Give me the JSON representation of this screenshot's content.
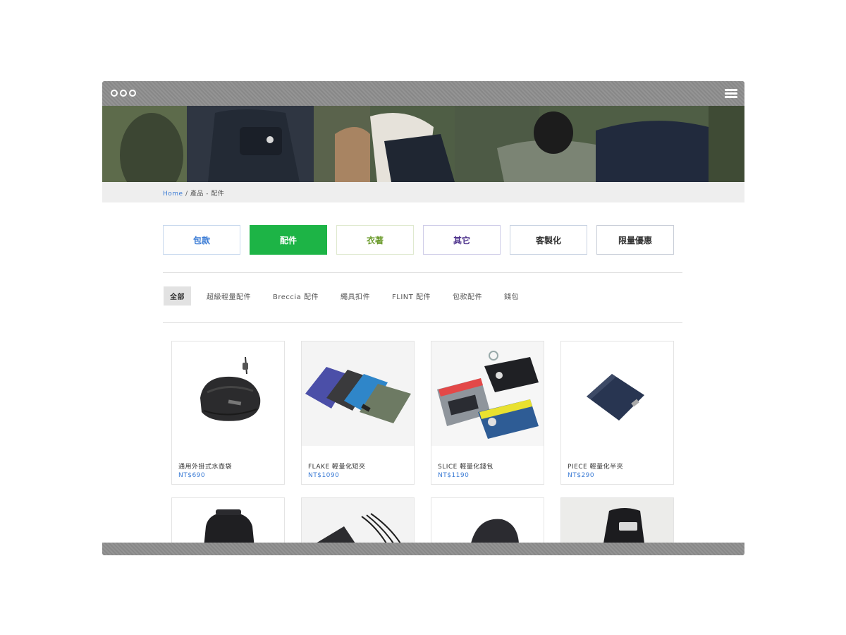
{
  "breadcrumb": {
    "home": "Home",
    "separator": "/",
    "current": "產品 - 配件"
  },
  "categories": [
    {
      "label": "包款",
      "color": "#3a7bd5",
      "border": "#c9d9ee",
      "bg": "#ffffff"
    },
    {
      "label": "配件",
      "color": "#ffffff",
      "border": "#1db446",
      "bg": "#1db446"
    },
    {
      "label": "衣著",
      "color": "#6a9a2a",
      "border": "#dfe9cf",
      "bg": "#ffffff"
    },
    {
      "label": "其它",
      "color": "#4a2f8a",
      "border": "#cfcde8",
      "bg": "#ffffff"
    },
    {
      "label": "客製化",
      "color": "#333333",
      "border": "#c9d3e2",
      "bg": "#ffffff"
    },
    {
      "label": "限量優惠",
      "color": "#333333",
      "border": "#c9ced8",
      "bg": "#ffffff"
    }
  ],
  "subcategories": [
    "全部",
    "超級輕量配件",
    "Breccia 配件",
    "繩具扣件",
    "FLINT 配件",
    "包款配件",
    "錢包"
  ],
  "products": [
    {
      "name": "通用外掛式水壺袋",
      "price": "NT$690"
    },
    {
      "name": "FLAKE 輕量化短夾",
      "price": "NT$1090"
    },
    {
      "name": "SLICE 輕量化錢包",
      "price": "NT$1190"
    },
    {
      "name": "PIECE 輕量化半夾",
      "price": "NT$290"
    }
  ],
  "icons": {
    "window_controls": "circle-outline-icon",
    "menu": "hamburger-menu-icon"
  },
  "colors": {
    "accent_green": "#1db446",
    "link_blue": "#3a7bd5",
    "chrome_gray": "#8e8e8e"
  }
}
